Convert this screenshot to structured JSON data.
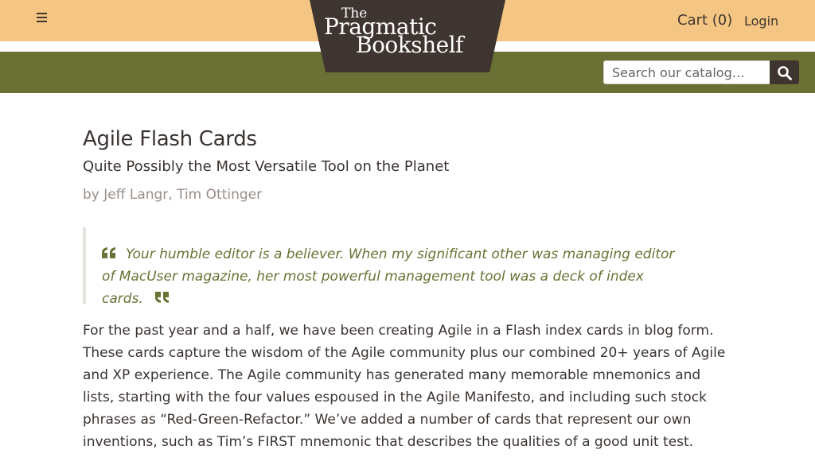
{
  "header": {
    "logo": {
      "line1": "The",
      "line2": "Pragmatic",
      "line3": "Bookshelf"
    },
    "cart_label": "Cart (0)",
    "login_label": "Login",
    "search": {
      "placeholder": "Search our catalog…"
    }
  },
  "colors": {
    "top_bar": "#f5c683",
    "nav_bar": "#6b7135",
    "logo_bg": "#3e3430",
    "quote_text": "#6b7135",
    "author_text": "#9a8f88"
  },
  "icons": {
    "menu": "hamburger-icon",
    "search": "search-icon",
    "quote_open": "quote-open-icon",
    "quote_close": "quote-close-icon"
  },
  "book": {
    "title": "Agile Flash Cards",
    "subtitle": "Quite Possibly the Most Versatile Tool on the Planet",
    "authors": "by Jeff Langr, Tim Ottinger",
    "quote": "Your humble editor is a believer. When my significant other was managing editor of MacUser magazine, her most powerful management tool was a deck of index cards.",
    "description": "For the past year and a half, we have been creating Agile in a Flash index cards in blog form. These cards capture the wisdom of the Agile community plus our combined 20+ years of Agile and XP experience. The Agile community has generated many memorable mnemonics and lists, starting with the four values espoused in the Agile Manifesto, and including such stock phrases as “Red-Green-Refactor.” We’ve added a number of cards that represent our own inventions, such as Tim’s FIRST mnemonic that describes the qualities of a good unit test."
  }
}
